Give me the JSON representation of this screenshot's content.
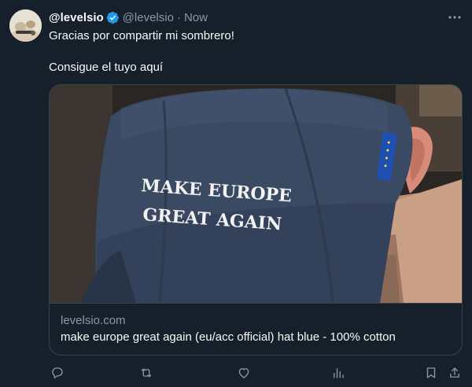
{
  "tweet": {
    "author_name": "@levelsio",
    "author_handle": "@levelsio",
    "separator": "·",
    "timestamp": "Now",
    "text_line1": "Gracias por compartir mi sombrero!",
    "text_line2": "Consigue el tuyo aquí"
  },
  "card": {
    "domain": "levelsio.com",
    "title": "make europe great again (eu/acc official) hat blue - 100% cotton",
    "image_text_line1": "MAKE EUROPE",
    "image_text_line2": "GREAT AGAIN"
  },
  "actions": {
    "icons": [
      "reply-icon",
      "retweet-icon",
      "like-icon",
      "views-icon",
      "bookmark-icon",
      "share-icon"
    ]
  },
  "colors": {
    "background": "#15202b",
    "text": "#f7f9f9",
    "secondary_text": "#8b98a5",
    "border": "#38444d",
    "verified": "#1d9bf0",
    "cap_navy": "#3a4a63"
  }
}
